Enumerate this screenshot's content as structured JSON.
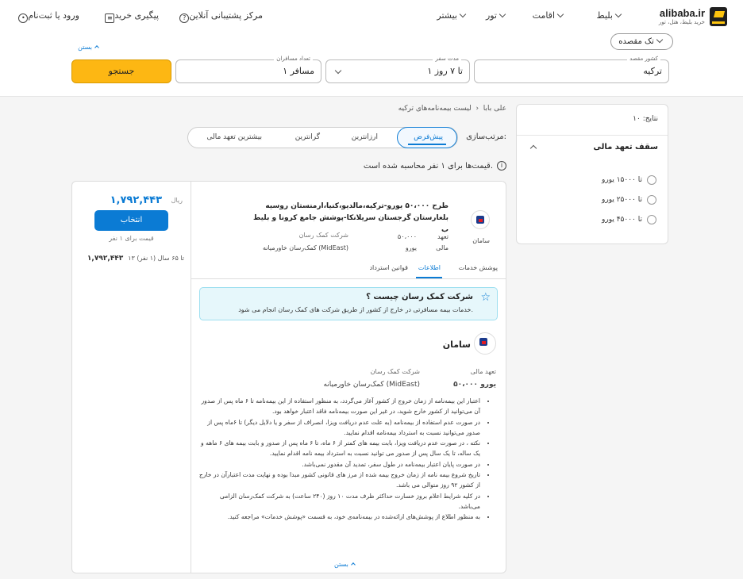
{
  "header": {
    "logo_text": "alibaba.ir",
    "logo_sub": "خرید بلیط، هتل، تور",
    "nav": [
      {
        "label": "بلیط"
      },
      {
        "label": "اقامت"
      },
      {
        "label": "تور"
      },
      {
        "label": "بیشتر"
      }
    ],
    "support": "مرکز پشتیبانی آنلاین",
    "track": "پیگیری خرید",
    "login": "ورود یا ثبت‌نام"
  },
  "search": {
    "trip_type": "تک مقصده",
    "close": "بستن",
    "country_label": "کشور مقصد",
    "country_value": "ترکیه",
    "duration_label": "مدت سفر",
    "duration_value": "۱ تا ۷ روز",
    "passengers_label": "تعداد مسافران",
    "passengers_value": "۱ مسافر",
    "search_button": "جستجو"
  },
  "sidebar": {
    "results": "نتایج: ۱۰",
    "filter_title": "سقف تعهد مالی",
    "options": [
      "تا ۱۵۰۰۰ یورو",
      "تا ۲۵۰۰۰ یورو",
      "تا ۴۵۰۰۰ یورو"
    ]
  },
  "main": {
    "breadcrumb_home": "علی بابا",
    "breadcrumb_current": "لیست بیمه‌نامه‌های ترکیه",
    "sort_label": "مرتب‌سازی:",
    "sort_options": [
      "پیش‌فرض",
      "ارزانترین",
      "گرانترین",
      "بیشترین تعهد مالی"
    ],
    "price_note": "قیمت‌ها برای ۱ نفر محاسبه شده است."
  },
  "card": {
    "price": "۱,۷۹۲,۴۴۳",
    "price_unit": "ریال",
    "select_button": "انتخاب",
    "per_person": "قیمت برای ۱ نفر",
    "age_range": "۱۳ تا ۶۵ سال (۱ نفر)",
    "age_price": "۱,۷۹۲,۴۴۳",
    "plan_title": "طرح ۵۰،۰۰۰ یورو-ترکیه،مالدیو،کنیا،ارمنستان روسیه بلغارستان گرجستان سریلانکا-پوشش جامع کرونا و بلیط ب",
    "insurer": "سامان",
    "commitment_label": "تعهد مالی",
    "commitment_value": "۵۰،۰۰۰ یورو",
    "assist_label": "شرکت کمک رسان",
    "assist_value": "کمک‌رسان خاورمیانه (MidEast)",
    "tabs": [
      "پوشش خدمات",
      "اطلاعات",
      "قوانین استرداد"
    ],
    "alert_title": "شرکت کمک رسان چیست ؟",
    "alert_desc": "خدمات بیمه مسافرتی در خارج از کشور از طریق شرکت های کمک رسان انجام می شود.",
    "detail_assist_value": "کمک‌رسان خاورمیانه (MidEast)",
    "bullets": [
      "اعتبار این بیمه‌نامه از زمان خروج از کشور آغاز می‌گردد، به منظور استفاده از این بیمه‌نامه تا ۶ ماه پس از صدور آن می‌توانید از کشور خارج شوید، در غیر این صورت بیمه‌نامه فاقد اعتبار خواهد بود.",
      "در صورت عدم استفاده از بیمه‌نامه (به علت عدم دریافت ویزا، انصراف از سفر و یا دلایل دیگر) تا ۶ماه پس از صدور می‌توانید نسبت به استرداد بیمه‌نامه اقدام نمایید.",
      "نکته ، در صورت عدم دریافت ویزا، بابت بیمه های کمتر از ۶ ماه، تا ۶ ماه پس از صدور و بابت بیمه های ۶ ماهه و یک ساله، تا یک سال پس از صدور می توانید نسبت به استرداد بیمه نامه اقدام نمایید.",
      "در صورت پایان اعتبار بیمه‌نامه در طول سفر، تمدید آن مقدور نمی‌باشد.",
      "تاریخ شروع بیمه نامه از زمان خروج بیمه شده از مرز های قانونی کشور مبدا بوده و نهایت مدت اعتبارآن در خارج از کشور ۹۲ روز متوالی می باشد.",
      "در کلیه شرایط اعلام بروز خسارت حداکثر ظرف مدت ۱۰ روز (۲۴۰ ساعت) به شرکت کمک‌رسان الزامی می‌باشد.",
      "به منظور اطلاع از پوشش‌های ارائه‌شده در بیمه‌نامه‌ی خود، به قسمت «پوشش خدمات» مراجعه کنید."
    ],
    "close": "بستن"
  },
  "colors": {
    "accent": "#0b7bd4",
    "search_button": "#fdb713",
    "alert_bg": "#e6f7fb"
  }
}
